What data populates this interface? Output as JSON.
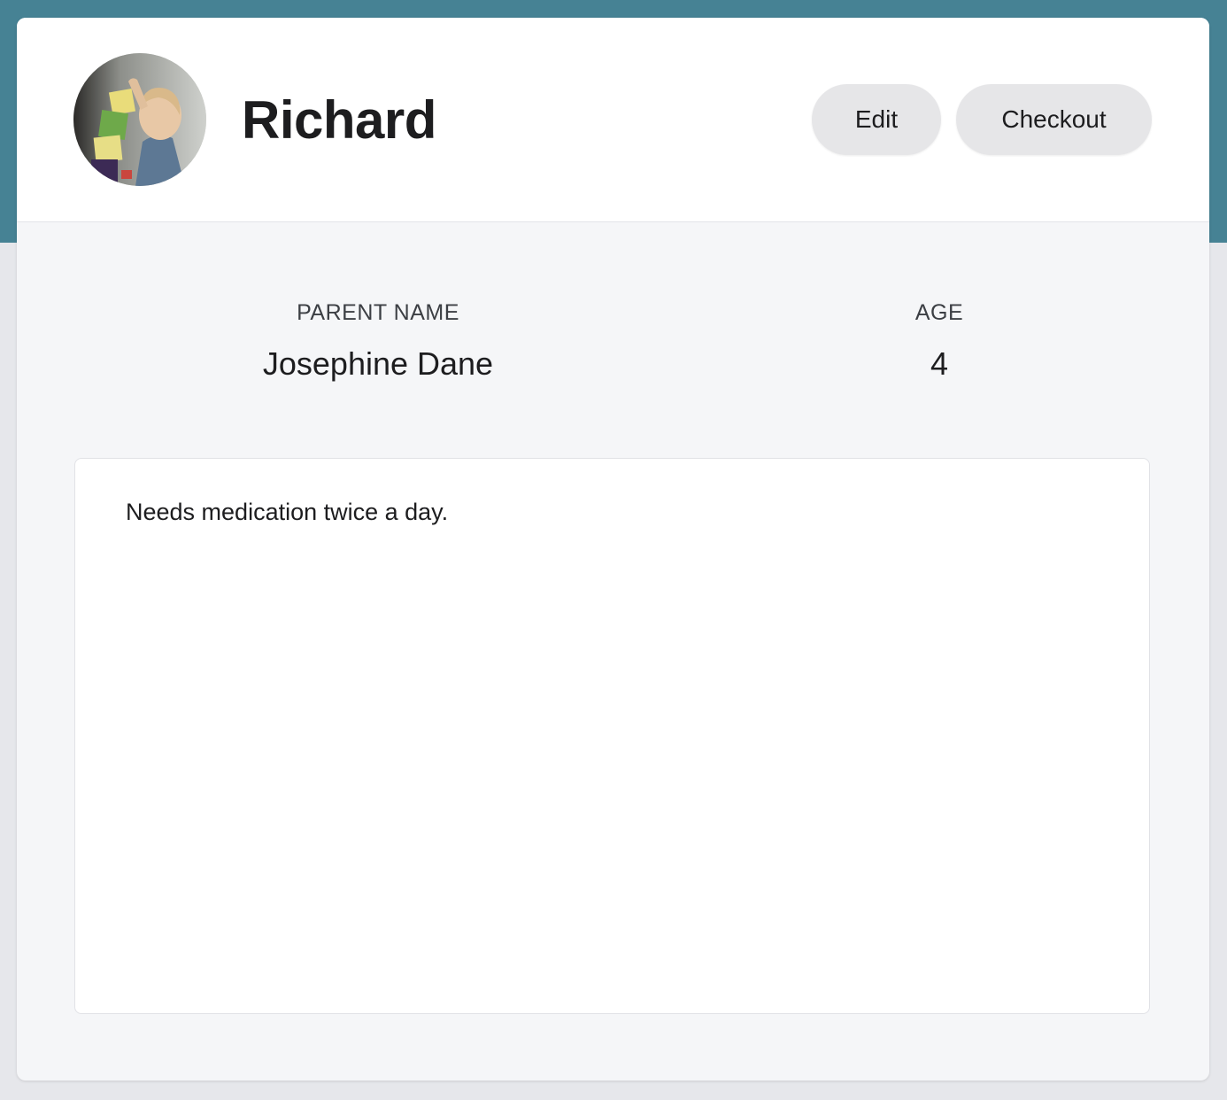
{
  "theme": {
    "header_band_color": "#468294",
    "page_background": "#e6e7eb",
    "card_background": "#f5f6f8",
    "button_background": "#e6e6e8"
  },
  "profile": {
    "name": "Richard",
    "avatar_icon": "child-photo"
  },
  "actions": {
    "edit_label": "Edit",
    "checkout_label": "Checkout"
  },
  "details": {
    "parent_label": "PARENT NAME",
    "parent_value": "Josephine Dane",
    "age_label": "AGE",
    "age_value": "4"
  },
  "notes": {
    "text": "Needs medication twice a day."
  }
}
